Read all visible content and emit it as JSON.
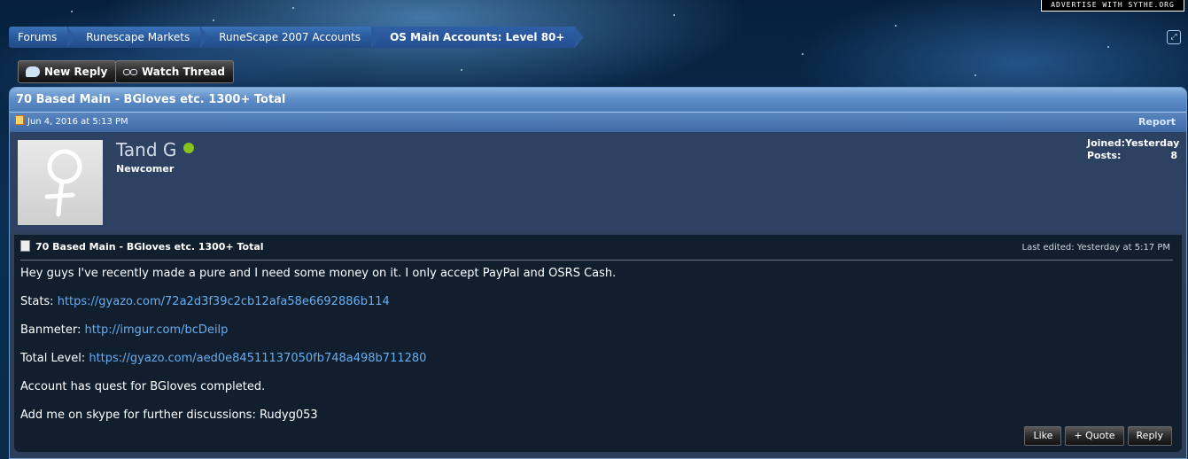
{
  "advertise": "ADVERTISE WITH SYTHE.ORG",
  "breadcrumb": [
    "Forums",
    "Runescape Markets",
    "RuneScape 2007 Accounts",
    "OS Main Accounts: Level 80+"
  ],
  "thread_buttons": {
    "new_reply": "New Reply",
    "watch_thread": "Watch Thread"
  },
  "thread": {
    "title": "70 Based Main - BGloves etc. 1300+ Total"
  },
  "post": {
    "date": "Jun 4, 2016 at 5:13 PM",
    "report": "Report",
    "author": {
      "name": "Tand G",
      "title": "Newcomer"
    },
    "stats": {
      "joined_label": "Joined:",
      "joined_value": "Yesterday",
      "posts_label": "Posts:",
      "posts_value": "8"
    },
    "title": "70 Based Main - BGloves etc. 1300+ Total",
    "last_edited": "Last edited: Yesterday at 5:17 PM",
    "lines": {
      "intro": "Hey guys I've recently made a pure and I need some money on it. I only accept PayPal and OSRS Cash.",
      "stats_label": "Stats: ",
      "stats_link": "https://gyazo.com/72a2d3f39c2cb12afa58e6692886b114",
      "banmeter_label": "Banmeter: ",
      "banmeter_link": "http://imgur.com/bcDeilp",
      "total_label": "Total Level: ",
      "total_link": "https://gyazo.com/aed0e84511137050fb748a498b711280",
      "quest": "Account has quest for BGloves completed.",
      "skype": "Add me on skype for further discussions: Rudyg053"
    },
    "actions": {
      "like": "Like",
      "quote": "+ Quote",
      "reply": "Reply"
    }
  },
  "colors": {
    "online": "#88c31a",
    "link": "#68aef0"
  }
}
